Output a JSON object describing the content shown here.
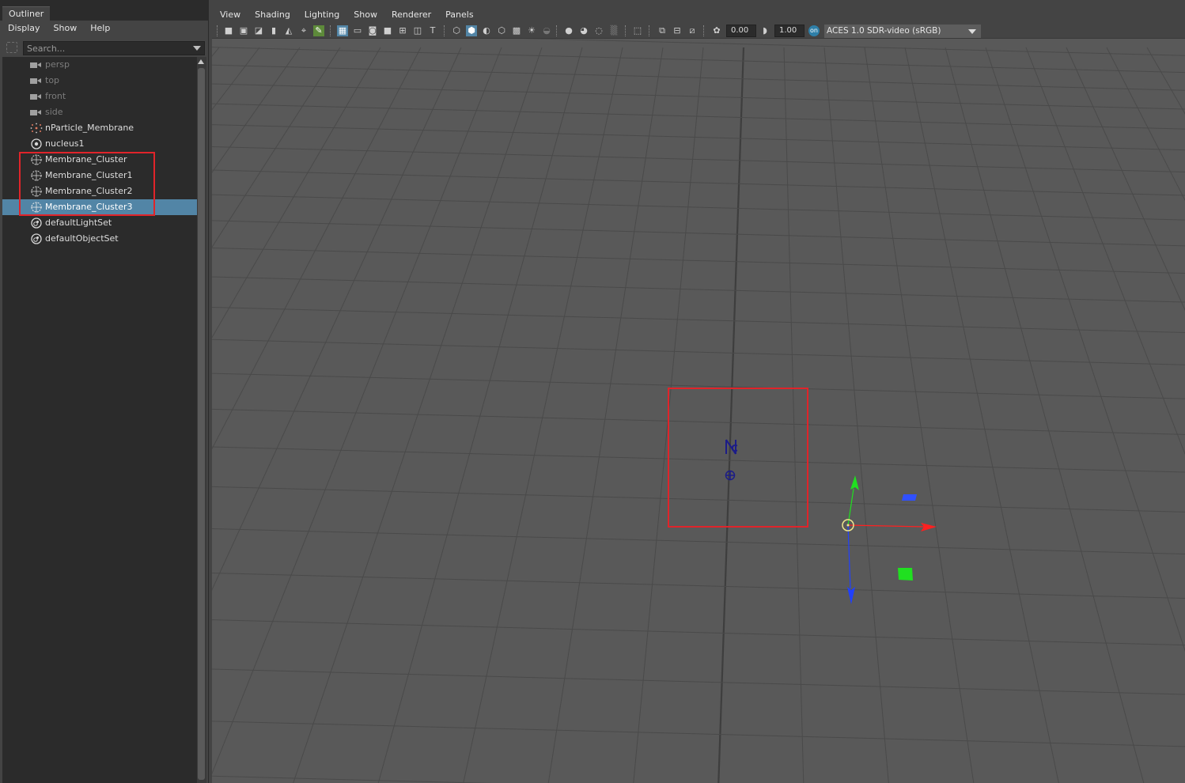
{
  "outliner": {
    "tab_title": "Outliner",
    "menu": [
      "Display",
      "Show",
      "Help"
    ],
    "search_placeholder": "Search...",
    "items": [
      {
        "label": "persp",
        "type": "camera",
        "icon": "camera-icon"
      },
      {
        "label": "top",
        "type": "camera",
        "icon": "camera-icon"
      },
      {
        "label": "front",
        "type": "camera",
        "icon": "camera-icon"
      },
      {
        "label": "side",
        "type": "camera",
        "icon": "camera-icon"
      },
      {
        "label": "nParticle_Membrane",
        "type": "nparticle",
        "icon": "nparticle-icon"
      },
      {
        "label": "nucleus1",
        "type": "nucleus",
        "icon": "nucleus-icon"
      },
      {
        "label": "Membrane_Cluster",
        "type": "cluster",
        "icon": "cluster-icon"
      },
      {
        "label": "Membrane_Cluster1",
        "type": "cluster",
        "icon": "cluster-icon"
      },
      {
        "label": "Membrane_Cluster2",
        "type": "cluster",
        "icon": "cluster-icon"
      },
      {
        "label": "Membrane_Cluster3",
        "type": "cluster",
        "icon": "cluster-icon",
        "selected": true
      },
      {
        "label": "defaultLightSet",
        "type": "set",
        "icon": "set-icon"
      },
      {
        "label": "defaultObjectSet",
        "type": "set",
        "icon": "set-icon"
      }
    ],
    "selection_color": "#5285a6"
  },
  "viewport": {
    "menu": [
      "View",
      "Shading",
      "Lighting",
      "Show",
      "Renderer",
      "Panels"
    ],
    "exposure_value": "0.00",
    "gamma_value": "1.00",
    "color_space": "ACES 1.0 SDR-video (sRGB)",
    "background_color": "#595959",
    "grid_color": "#4a4a4a",
    "axis_colors": {
      "x": "#ff2020",
      "y": "#20e020",
      "z": "#2040ff"
    }
  },
  "annotation_color": "#e0242a"
}
